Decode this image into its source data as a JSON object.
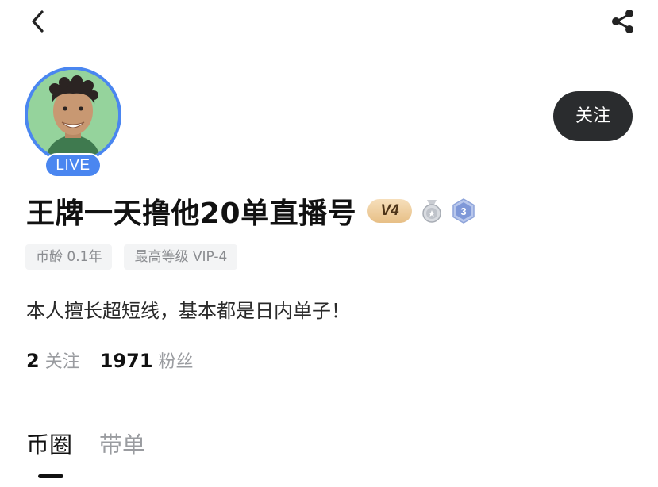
{
  "header": {
    "back_icon": "chevron-left-icon",
    "share_icon": "share-icon"
  },
  "profile": {
    "live_label": "LIVE",
    "follow_label": "关注",
    "name": "王牌一天撸他20单直播号",
    "vip_badge": "V4",
    "medal_level": "3",
    "tags": [
      "币龄 0.1年",
      "最高等级 VIP-4"
    ],
    "bio": "本人擅长超短线，基本都是日内单子！",
    "stats": {
      "following_count": "2",
      "following_label": "关注",
      "followers_count": "1971",
      "followers_label": "粉丝"
    }
  },
  "tabs": [
    {
      "label": "币圈",
      "active": true
    },
    {
      "label": "带单",
      "active": false
    }
  ],
  "colors": {
    "accent_blue": "#4a86f0",
    "follow_button_bg": "#2a2c2e",
    "muted_text": "#9a9ca0"
  }
}
